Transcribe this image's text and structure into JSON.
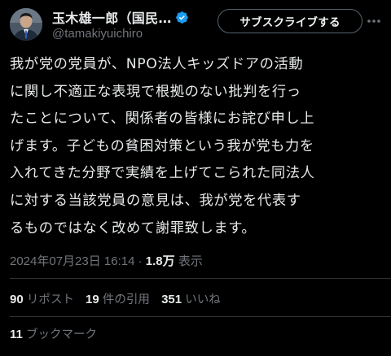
{
  "header": {
    "display_name": "玉木雄一郎（国民…",
    "handle": "@tamakiyuichiro",
    "subscribe_label": "サブスクライブする",
    "verified_color": "#1d9bf0"
  },
  "tweet": {
    "lines": [
      "我が党の党員が、NPO法人キッズドアの活動",
      "に関し不適正な表現で根拠のない批判を行っ",
      "たことについて、関係者の皆様にお詫び申し上",
      "げます。子どもの貧困対策という我が党も力を",
      "入れてきた分野で実績を上げてこられた同法人",
      "に対する当該党員の意見は、我が党を代表す",
      "るものではなく改めて謝罪致します。"
    ]
  },
  "meta": {
    "timestamp": "2024年07月23日 16:14",
    "separator": "·",
    "views_count": "1.8万",
    "views_label": "表示"
  },
  "stats": {
    "reposts": {
      "count": "90",
      "label": "リポスト"
    },
    "quotes": {
      "count": "19",
      "label": "件の引用"
    },
    "likes": {
      "count": "351",
      "label": "いいね"
    },
    "bookmarks": {
      "count": "11",
      "label": "ブックマーク"
    }
  },
  "colors": {
    "background": "#000000",
    "text_primary": "#e7e9ea",
    "text_secondary": "#71767b",
    "divider": "#2f3336"
  }
}
